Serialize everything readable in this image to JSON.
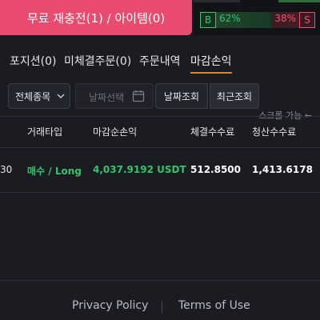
{
  "topbar": {
    "refill_label": "무료 재충전(1) / 아이템(0)",
    "ratio": {
      "buy_badge": "B",
      "buy_pct": "62%",
      "sell_pct": "38%",
      "sell_badge": "S",
      "buy_fraction": 0.62,
      "colors": {
        "buy": "#35c46a",
        "sell": "#f0506e"
      }
    }
  },
  "tabs": [
    {
      "label": "포지션(0)"
    },
    {
      "label": "미체결주문(0)"
    },
    {
      "label": "주문내역"
    },
    {
      "label": "마감손익"
    }
  ],
  "active_tab_index": 3,
  "filters": {
    "symbol_select": "전체종목",
    "date_placeholder": "날짜선택",
    "date_search_label": "날짜조회",
    "recent_search_label": "최근조회"
  },
  "scroll_hint": "스크롤 가능 ←",
  "table": {
    "columns": [
      "거래타입",
      "마감순손익",
      "체결수수료",
      "청산수수료"
    ],
    "rows": [
      {
        "cut": "30",
        "trade_type": "매수 / Long",
        "net_pnl": "4,037.9192 USDT",
        "exec_fee": "512.8500",
        "liq_fee": "1,413.6178"
      }
    ],
    "colors": {
      "positive": "#35c46a"
    }
  },
  "footer": {
    "privacy": "Privacy Policy",
    "terms": "Terms of Use"
  },
  "icons": [
    "chevron-down-icon",
    "calendar-icon"
  ],
  "accent": {
    "refill": "#e94b6f",
    "tab_underline": "#d9842b"
  }
}
